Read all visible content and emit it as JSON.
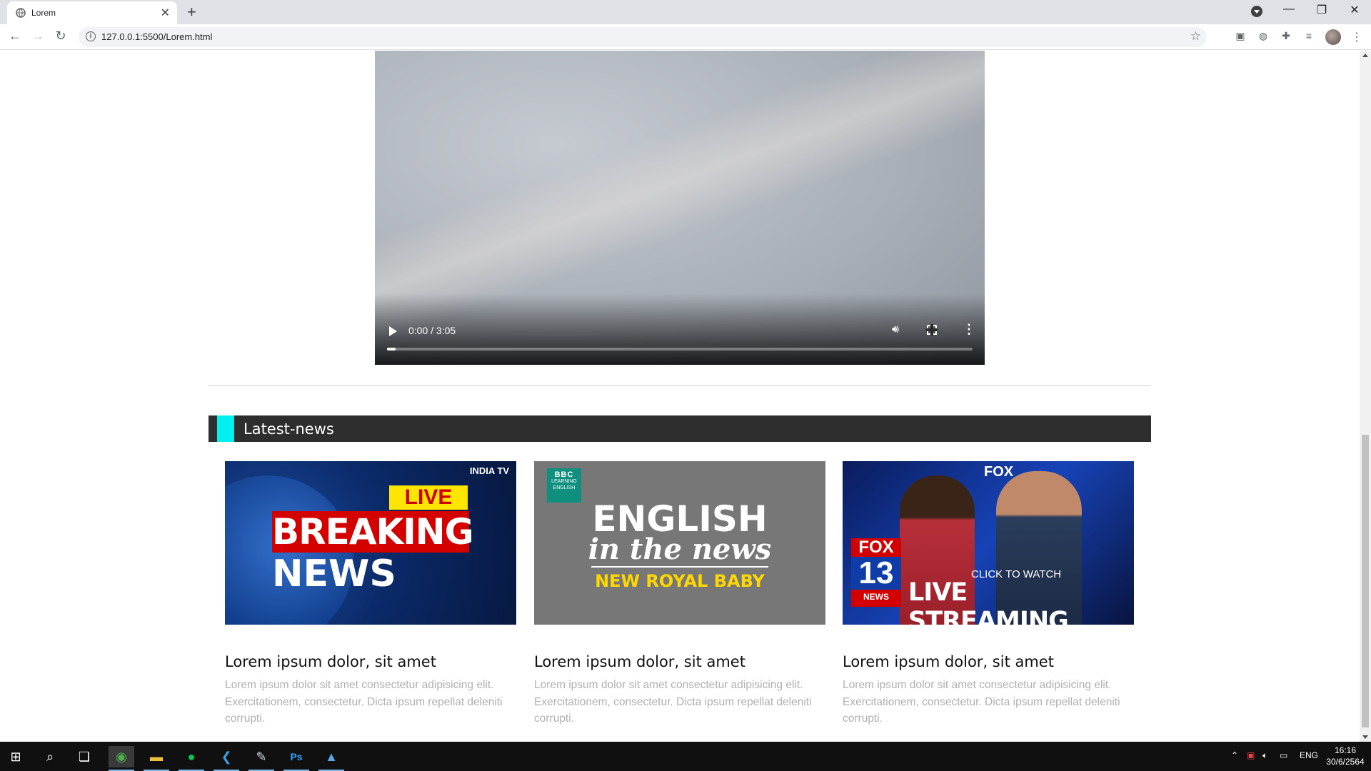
{
  "browser": {
    "tab_title": "Lorem",
    "url": "127.0.0.1:5500/Lorem.html"
  },
  "video": {
    "time": "0:00 / 3:05",
    "progress": 0.015
  },
  "section": {
    "title": "Latest-news"
  },
  "cards": [
    {
      "title": "Lorem ipsum dolor, sit amet",
      "text": "Lorem ipsum dolor sit amet consectetur adipisicing elit. Exercitationem, consectetur. Dicta ipsum repellat deleniti corrupti.",
      "image": {
        "brand": "INDIA TV",
        "live": "LIVE",
        "breaking": "BREAKING",
        "news": "NEWS"
      }
    },
    {
      "title": "Lorem ipsum dolor, sit amet",
      "text": "Lorem ipsum dolor sit amet consectetur adipisicing elit. Exercitationem, consectetur. Dicta ipsum repellat deleniti corrupti.",
      "image": {
        "logo": "BBC",
        "logo_sub": "LEARNING ENGLISH",
        "english": "ENGLISH",
        "in_the_news": "in the news",
        "royal": "NEW ROYAL BABY"
      }
    },
    {
      "title": "Lorem ipsum dolor, sit amet",
      "text": "Lorem ipsum dolor sit amet consectetur adipisicing elit. Exercitationem, consectetur. Dicta ipsum repellat deleniti corrupti.",
      "image": {
        "fox": "FOX",
        "num": "13",
        "news": "NEWS",
        "click": "CLICK TO WATCH",
        "stream": "LIVE STREAMING"
      }
    }
  ],
  "taskbar": {
    "lang": "ENG",
    "time": "16:16",
    "date": "30/6/2564"
  },
  "colors": {
    "accent": "#00f0f0",
    "section_bg": "#2e2e2e"
  }
}
